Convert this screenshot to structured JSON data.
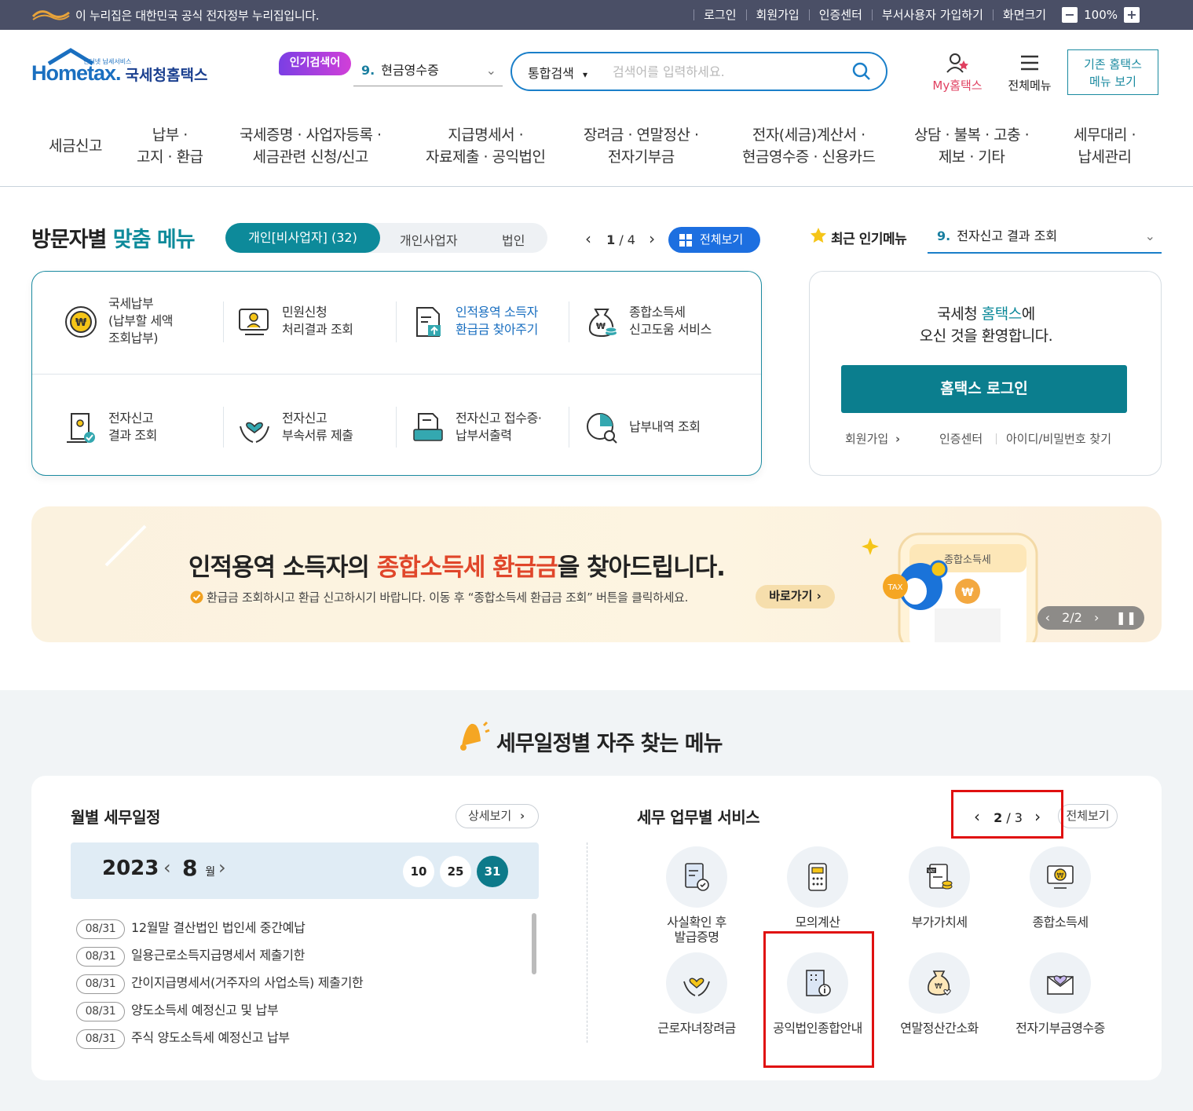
{
  "govbar": {
    "notice": "이 누리집은 대한민국 공식 전자정부 누리집입니다.",
    "links": [
      "로그인",
      "회원가입",
      "인증센터",
      "부서사용자 가입하기",
      "화면크기"
    ],
    "zoom": "100%"
  },
  "header": {
    "logo_small": "인터넷 납세서비스",
    "logo_text": "Hometax.",
    "logo_kor": "국세청홈택스",
    "popular_badge": "인기검색어",
    "popular_num": "9.",
    "popular_term": "현금영수증",
    "search_scope": "통합검색",
    "search_placeholder": "검색어를 입력하세요.",
    "my_label": "My홈택스",
    "allmenu_label": "전체메뉴",
    "oldhome_line1": "기존 홈택스",
    "oldhome_line2": "메뉴 보기"
  },
  "gnb": [
    [
      "세금신고"
    ],
    [
      "납부 ·",
      "고지 · 환급"
    ],
    [
      "국세증명 · 사업자등록 ·",
      "세금관련 신청/신고"
    ],
    [
      "지급명세서 ·",
      "자료제출 · 공익법인"
    ],
    [
      "장려금 · 연말정산 ·",
      "전자기부금"
    ],
    [
      "전자(세금)계산서 ·",
      "현금영수증 · 신용카드"
    ],
    [
      "상담 · 불복 · 고충 ·",
      "제보 · 기타"
    ],
    [
      "세무대리 ·",
      "납세관리"
    ]
  ],
  "visitor": {
    "title_a": "방문자별",
    "title_b": "맞춤 메뉴",
    "tabs": [
      "개인[비사업자] (32)",
      "개인사업자",
      "법인"
    ],
    "page_cur": "1",
    "page_total": "/ 4",
    "all_label": "전체보기",
    "items": [
      {
        "lines": [
          "국세납부",
          "(납부할 세액",
          "조회납부)"
        ],
        "highlight": false
      },
      {
        "lines": [
          "민원신청",
          "처리결과 조회"
        ],
        "highlight": false
      },
      {
        "lines": [
          "인적용역 소득자",
          "환급금 찾아주기"
        ],
        "highlight": true
      },
      {
        "lines": [
          "종합소득세",
          "신고도움 서비스"
        ],
        "highlight": false
      },
      {
        "lines": [
          "전자신고",
          "결과 조회"
        ],
        "highlight": false
      },
      {
        "lines": [
          "전자신고",
          "부속서류 제출"
        ],
        "highlight": false
      },
      {
        "lines": [
          "전자신고 접수증·",
          "납부서출력"
        ],
        "highlight": false
      },
      {
        "lines": [
          "납부내역 조회"
        ],
        "highlight": false
      }
    ]
  },
  "popular_right": {
    "title": "최근 인기메뉴",
    "num": "9.",
    "term": "전자신고 결과 조회"
  },
  "login": {
    "welcome_a": "국세청",
    "welcome_hl": "홈택스",
    "welcome_b": "에",
    "welcome_2": "오신 것을 환영합니다.",
    "button": "홈택스 로그인",
    "join": "회원가입",
    "cert": "인증센터",
    "find": "아이디/비밀번호 찾기"
  },
  "banner": {
    "h_a": "인적용역 소득자의",
    "h_red": "종합소득세 환급금",
    "h_b": "을 찾아드립니다.",
    "sub": "환급금 조회하시고 환급 신고하시기 바랍니다. 이동 후 “종합소득세 환급금 조회” 버튼을 클릭하세요.",
    "go": "바로가기",
    "phone_title": "종합소득세",
    "coin": "TAX",
    "pager": "2/2"
  },
  "schedule_section": {
    "title": "세무일정별 자주 찾는 메뉴",
    "monthly_title": "월별 세무일정",
    "detail": "상세보기",
    "year": "2023",
    "month": "8",
    "month_unit": "월",
    "days": [
      "10",
      "25",
      "31"
    ],
    "active_day": "31",
    "items": [
      {
        "date": "08/31",
        "text": "12월말 결산법인 법인세 중간예납"
      },
      {
        "date": "08/31",
        "text": "일용근로소득지급명세서 제출기한"
      },
      {
        "date": "08/31",
        "text": "간이지급명세서(거주자의 사업소득) 제출기한"
      },
      {
        "date": "08/31",
        "text": "양도소득세 예정신고 및 납부"
      },
      {
        "date": "08/31",
        "text": "주식 양도소득세 예정신고 납부"
      }
    ]
  },
  "services": {
    "title": "세무 업무별 서비스",
    "page_cur": "2",
    "page_total": "/ 3",
    "all_label": "전체보기",
    "items": [
      {
        "label": "사실확인 후\n발급증명",
        "icon": "certificate-icon"
      },
      {
        "label": "모의계산",
        "icon": "calculator-icon"
      },
      {
        "label": "부가가치세",
        "icon": "vat-icon"
      },
      {
        "label": "종합소득세",
        "icon": "income-tax-icon"
      },
      {
        "label": "근로자녀장려금",
        "icon": "hands-heart-icon"
      },
      {
        "label": "공익법인종합안내",
        "icon": "building-info-icon"
      },
      {
        "label": "연말정산간소화",
        "icon": "money-bag-icon"
      },
      {
        "label": "전자기부금영수증",
        "icon": "envelope-heart-icon"
      }
    ]
  },
  "colors": {
    "primary": "#0d8a9a",
    "blue": "#1d6fe0",
    "highlight_red": "#e01010",
    "govbar": "#4a4f66"
  }
}
